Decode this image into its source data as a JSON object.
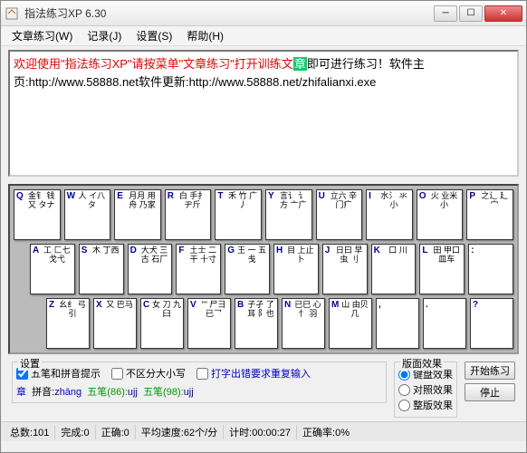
{
  "window": {
    "title": "指法练习XP 6.30"
  },
  "menu": {
    "items": [
      "文章练习(W)",
      "记录(J)",
      "设置(S)",
      "帮助(H)"
    ]
  },
  "text": {
    "red": "欢迎使用\"指法练习XP\"请按菜单\"文章练习\"打开训练文",
    "hl": "章",
    "black": "即可进行练习！软件主页:http://www.58888.net软件更新:http://www.58888.net/zhifalianxi.exe"
  },
  "keys": {
    "row1": [
      {
        "l": "Q",
        "c": "金钅\n钱又\nタナ"
      },
      {
        "l": "W",
        "c": "人\nイ八\nタ"
      },
      {
        "l": "E",
        "c": "月月\n用舟\n乃家"
      },
      {
        "l": "R",
        "c": "白\n手扌\nヂ斤"
      },
      {
        "l": "T",
        "c": "禾\n竹\n广丿"
      },
      {
        "l": "Y",
        "c": "言讠\n讠方\n亠广"
      },
      {
        "l": "U",
        "c": "立六\n辛\n门疒"
      },
      {
        "l": "I",
        "c": "水氵\n氺\n小"
      },
      {
        "l": "O",
        "c": "火\n业米\n小"
      },
      {
        "l": "P",
        "c": "之辶\n廴\n宀"
      }
    ],
    "row2": [
      {
        "l": "A",
        "c": "工\n匚七\n戈弋"
      },
      {
        "l": "S",
        "c": "木\n丁西"
      },
      {
        "l": "D",
        "c": "大犬\n三古\n石厂"
      },
      {
        "l": "F",
        "c": "土士\n二干\n十寸"
      },
      {
        "l": "G",
        "c": "王\n一\n五戋"
      },
      {
        "l": "H",
        "c": "目\n上止\n卜"
      },
      {
        "l": "J",
        "c": "日曰\n早虫\n刂"
      },
      {
        "l": "K",
        "c": "口\n川"
      },
      {
        "l": "L",
        "c": "田\n甲口\n皿车"
      },
      {
        "l": ":",
        "c": ""
      }
    ],
    "row3": [
      {
        "l": "Z",
        "c": "幺纟\n弓\n引"
      },
      {
        "l": "X",
        "c": "又\n巴马\n"
      },
      {
        "l": "C",
        "c": "女\n刀\n九臼"
      },
      {
        "l": "V",
        "c": "\"\"\n尸彐\n已乛"
      },
      {
        "l": "B",
        "c": "子孑\n了耳\n阝也"
      },
      {
        "l": "N",
        "c": "已巳\n心忄\n羽"
      },
      {
        "l": "M",
        "c": "山\n由贝\n几"
      },
      {
        "l": ",",
        "c": ""
      },
      {
        "l": ".",
        "c": ""
      },
      {
        "l": "?",
        "c": ""
      }
    ]
  },
  "settings": {
    "label": "设置",
    "cb1": "五笔和拼音提示",
    "cb2": "不区分大小写",
    "cb3": "打字出错要求重复输入",
    "effect_label": "版面效果",
    "r1": "键盘效果",
    "r2": "对照效果",
    "r3": "整版效果",
    "btn_start": "开始练习",
    "btn_stop": "停止",
    "info_char": "章",
    "info_pinyin_lbl": "拼音:",
    "info_pinyin": "zhāng",
    "info_wb86_lbl": "五笔(86):",
    "info_wb86": "ujj",
    "info_wb98_lbl": "五笔(98):",
    "info_wb98": "ujj"
  },
  "status": {
    "total_lbl": "总数:",
    "total": "101",
    "done_lbl": "完成:",
    "done": "0",
    "ok_lbl": "正确:",
    "ok": "0",
    "spd_lbl": "平均速度:",
    "spd": "62个/分",
    "time_lbl": "计时:",
    "time": "00:00:27",
    "rate_lbl": "正确率:",
    "rate": "0%"
  }
}
